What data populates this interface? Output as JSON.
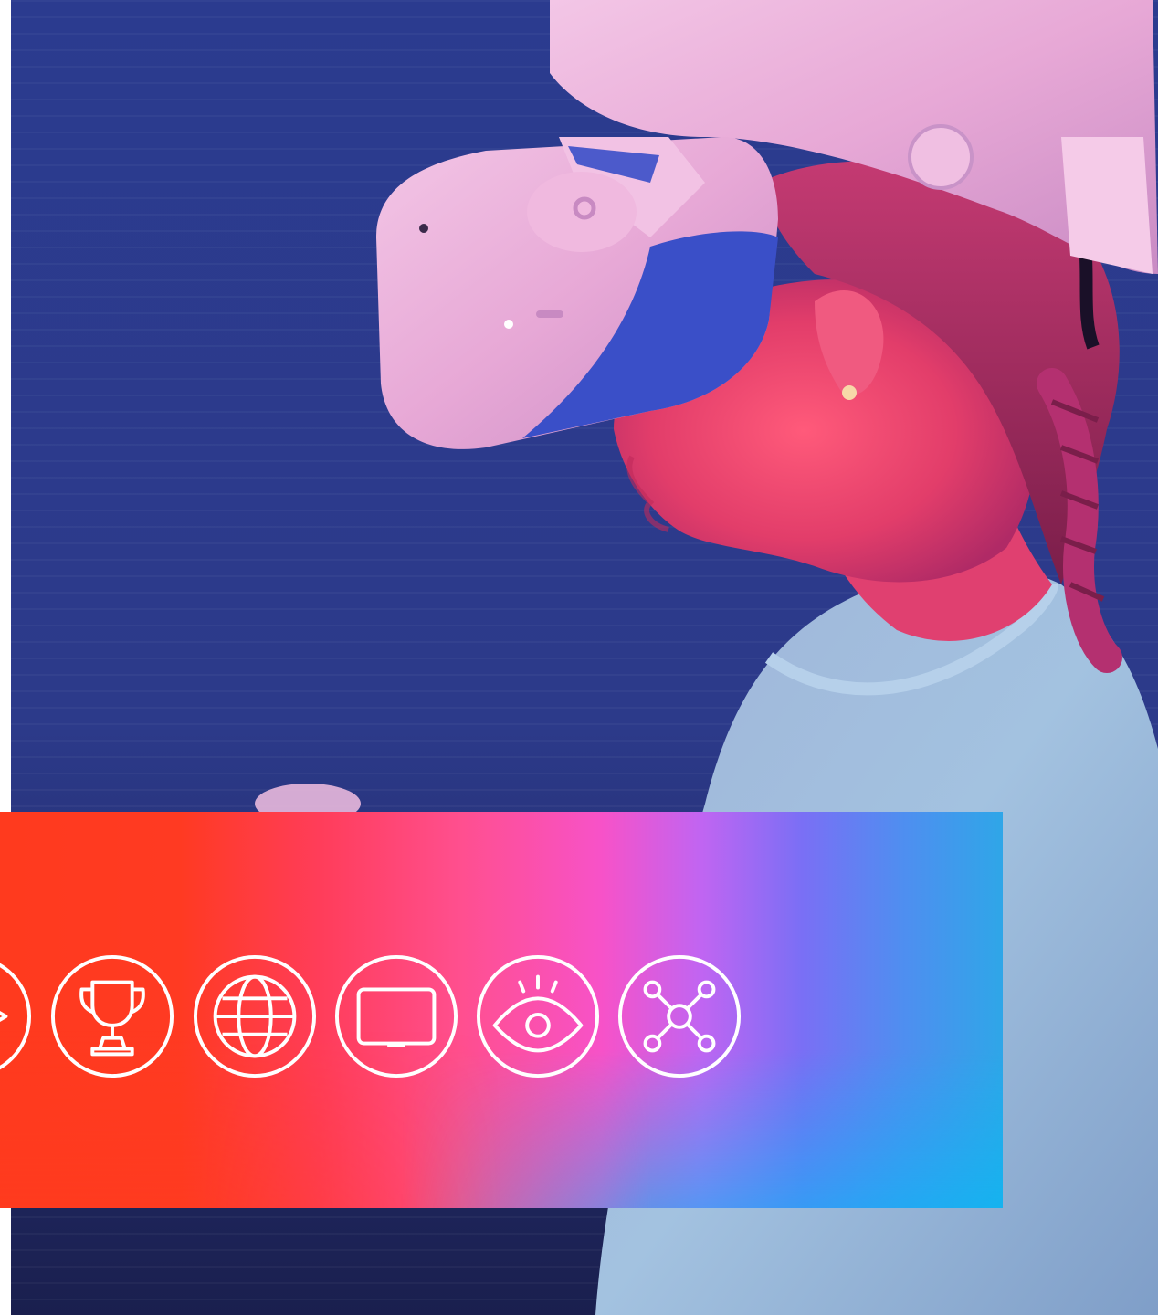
{
  "scene": {
    "kind": "photo",
    "subject": "child-wearing-vr-headset"
  },
  "colors": {
    "background_blue": "#2c3a8e",
    "band_left": "#ff3a1e",
    "band_mid": "#f752c8",
    "band_right": "#00b4f0",
    "icon_stroke": "#ffffff"
  },
  "icons": [
    {
      "name": "play-icon"
    },
    {
      "name": "trophy-icon"
    },
    {
      "name": "globe-icon"
    },
    {
      "name": "monitor-icon"
    },
    {
      "name": "eye-icon"
    },
    {
      "name": "network-icon"
    }
  ]
}
